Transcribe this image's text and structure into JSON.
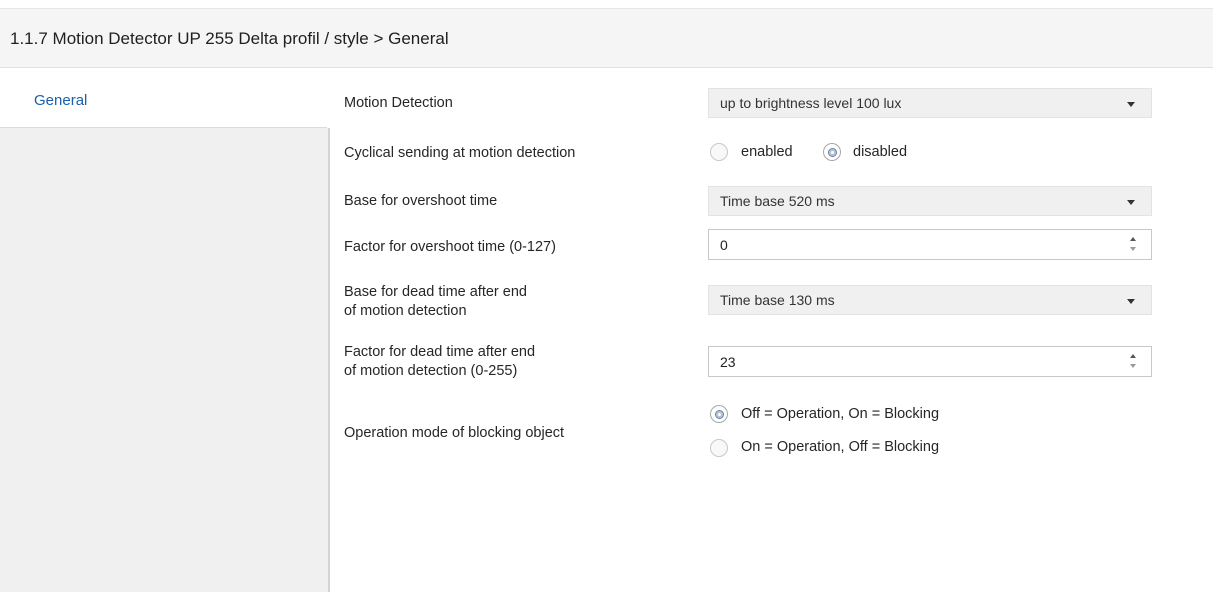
{
  "header": {
    "title": "1.1.7 Motion Detector UP 255 Delta profil / style > General"
  },
  "sidebar": {
    "tabs": [
      {
        "label": "General"
      }
    ]
  },
  "settings": {
    "motion_detection": {
      "label": "Motion Detection",
      "value": "up to brightness level 100 lux"
    },
    "cyclical_sending": {
      "label": "Cyclical sending at motion detection",
      "options": [
        {
          "label": "enabled",
          "selected": false
        },
        {
          "label": "disabled",
          "selected": true
        }
      ]
    },
    "overshoot_base": {
      "label": "Base for overshoot time",
      "value": "Time base 520 ms"
    },
    "overshoot_factor": {
      "label": "Factor for overshoot time (0-127)",
      "value": "0"
    },
    "dead_time_base": {
      "label_line1": "Base for dead time after end",
      "label_line2": "of motion detection",
      "value": "Time base 130 ms"
    },
    "dead_time_factor": {
      "label_line1": "Factor for dead time after end",
      "label_line2": "of motion detection (0-255)",
      "value": "23"
    },
    "blocking_mode": {
      "label": "Operation mode of blocking object",
      "options": [
        {
          "label": "Off = Operation, On = Blocking",
          "selected": true
        },
        {
          "label": "On = Operation, Off = Blocking",
          "selected": false
        }
      ]
    }
  },
  "icons": {
    "select_arrow": "chevron-down-icon",
    "spin_up": "spin-up-icon",
    "spin_down": "spin-down-icon"
  }
}
